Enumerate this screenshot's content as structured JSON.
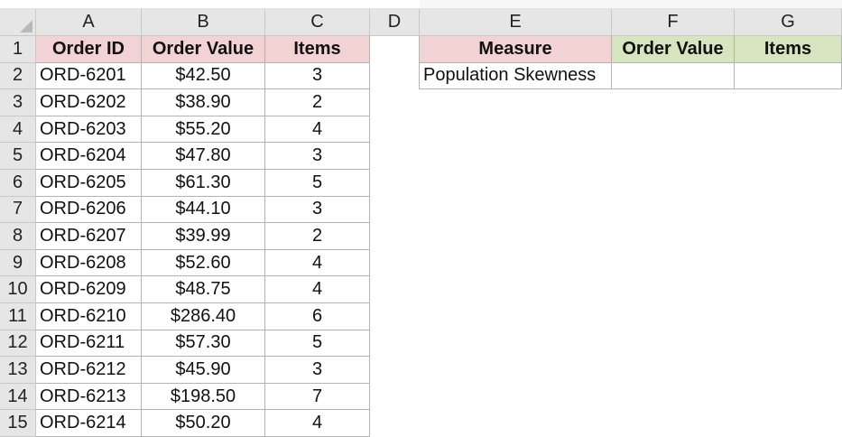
{
  "columns": [
    "A",
    "B",
    "C",
    "D",
    "E",
    "F",
    "G"
  ],
  "row_numbers": [
    "1",
    "2",
    "3",
    "4",
    "5",
    "6",
    "7",
    "8",
    "9",
    "10",
    "11",
    "12",
    "13",
    "14",
    "15"
  ],
  "table": {
    "headers": {
      "order_id": "Order ID",
      "order_value": "Order Value",
      "items": "Items"
    },
    "rows": [
      {
        "order_id": "ORD-6201",
        "order_value": "$42.50",
        "items": "3"
      },
      {
        "order_id": "ORD-6202",
        "order_value": "$38.90",
        "items": "2"
      },
      {
        "order_id": "ORD-6203",
        "order_value": "$55.20",
        "items": "4"
      },
      {
        "order_id": "ORD-6204",
        "order_value": "$47.80",
        "items": "3"
      },
      {
        "order_id": "ORD-6205",
        "order_value": "$61.30",
        "items": "5"
      },
      {
        "order_id": "ORD-6206",
        "order_value": "$44.10",
        "items": "3"
      },
      {
        "order_id": "ORD-6207",
        "order_value": "$39.99",
        "items": "2"
      },
      {
        "order_id": "ORD-6208",
        "order_value": "$52.60",
        "items": "4"
      },
      {
        "order_id": "ORD-6209",
        "order_value": "$48.75",
        "items": "4"
      },
      {
        "order_id": "ORD-6210",
        "order_value": "$286.40",
        "items": "6"
      },
      {
        "order_id": "ORD-6211",
        "order_value": "$57.30",
        "items": "5"
      },
      {
        "order_id": "ORD-6212",
        "order_value": "$45.90",
        "items": "3"
      },
      {
        "order_id": "ORD-6213",
        "order_value": "$198.50",
        "items": "7"
      },
      {
        "order_id": "ORD-6214",
        "order_value": "$50.20",
        "items": "4"
      }
    ]
  },
  "summary": {
    "headers": {
      "measure": "Measure",
      "order_value": "Order Value",
      "items": "Items"
    },
    "rows": [
      {
        "measure": "Population Skewness",
        "order_value": "",
        "items": ""
      }
    ]
  },
  "colors": {
    "header_pink": "#f2d3d3",
    "header_green": "#d6e4bf",
    "gridline": "#b4b4b4",
    "heading_bg": "#e6e6e6"
  }
}
